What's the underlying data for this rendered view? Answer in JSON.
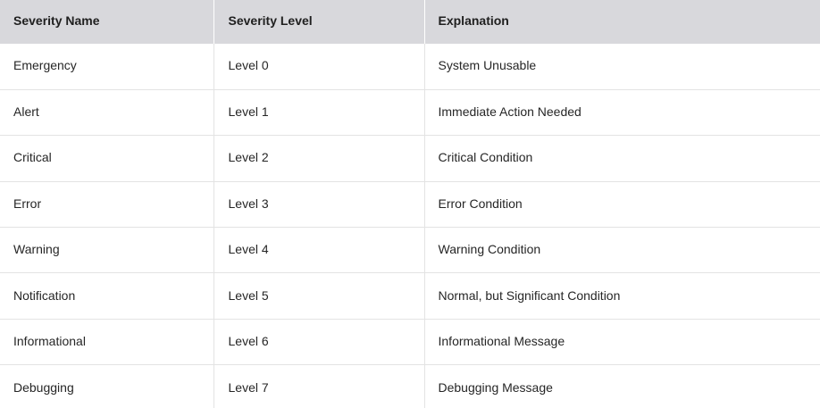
{
  "table": {
    "headers": [
      "Severity Name",
      "Severity Level",
      "Explanation"
    ],
    "rows": [
      [
        "Emergency",
        "Level 0",
        "System Unusable"
      ],
      [
        "Alert",
        "Level 1",
        "Immediate Action Needed"
      ],
      [
        "Critical",
        "Level 2",
        "Critical Condition"
      ],
      [
        "Error",
        "Level 3",
        "Error Condition"
      ],
      [
        "Warning",
        "Level 4",
        "Warning Condition"
      ],
      [
        "Notification",
        "Level 5",
        "Normal, but Significant Condition"
      ],
      [
        "Informational",
        "Level 6",
        "Informational Message"
      ],
      [
        "Debugging",
        "Level 7",
        "Debugging Message"
      ]
    ]
  },
  "colors": {
    "header_background": "#d8d8dc",
    "grid_line": "#e3e3e3",
    "text": "#262626"
  }
}
